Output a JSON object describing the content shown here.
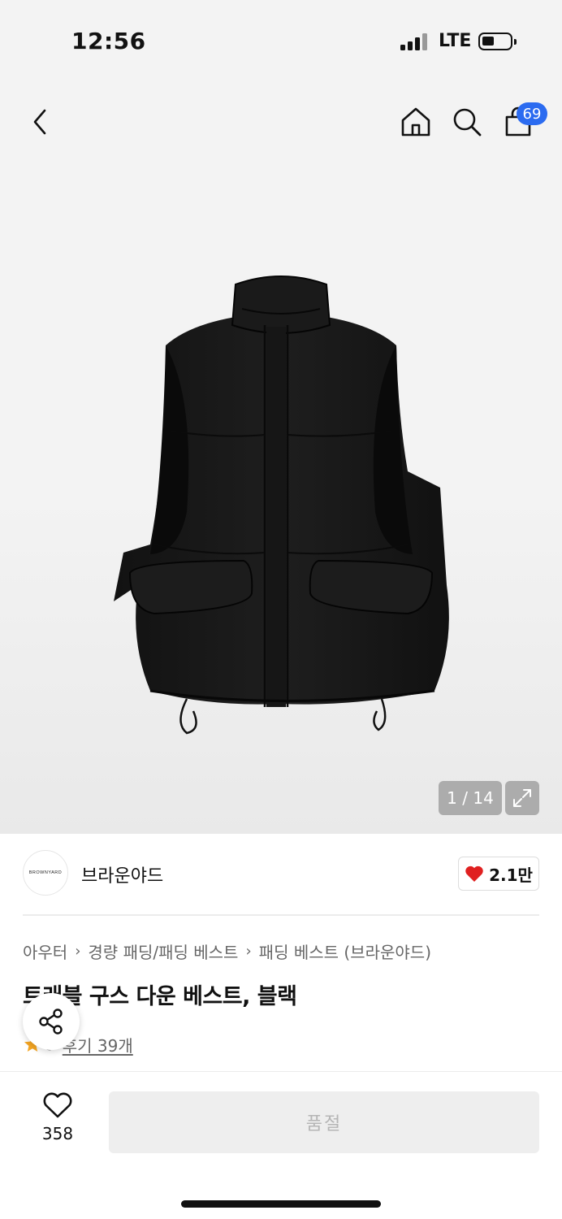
{
  "status_bar": {
    "time": "12:56",
    "network": "LTE"
  },
  "nav": {
    "back_icon": "chevron-left-icon",
    "home_icon": "home-icon",
    "search_icon": "search-icon",
    "cart_icon": "shopping-bag-icon",
    "cart_count": "69",
    "badge_color": "#2b6bf0"
  },
  "gallery": {
    "current_page": 1,
    "total_pages": 14,
    "pager_text": "1 / 14",
    "expand_icon": "expand-icon"
  },
  "brand": {
    "logo_text": "BROWNYARD",
    "name": "브라운야드",
    "like_count": "2.1만",
    "heart_color": "#e02020"
  },
  "breadcrumb": [
    "아우터",
    "경량 패딩/패딩 베스트",
    "패딩 베스트 (브라운야드)"
  ],
  "product": {
    "title": "트래블 구스 다운 베스트, 블랙"
  },
  "rating": {
    "score": "5",
    "reviews_label": "후기 39개",
    "star_color": "#f5a623"
  },
  "share": {
    "icon": "share-icon"
  },
  "bottom_bar": {
    "wish_count": "358",
    "buy_label": "품절"
  }
}
